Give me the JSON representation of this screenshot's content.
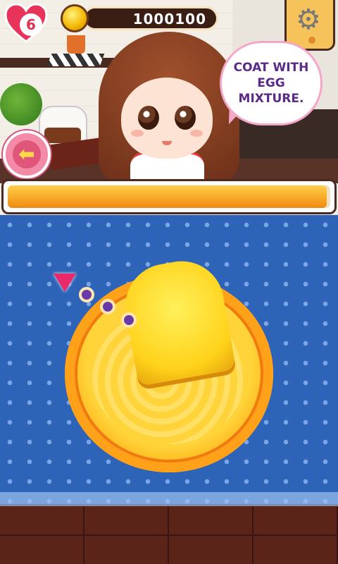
{
  "hud": {
    "lives": "6",
    "coins": "1000100"
  },
  "speech": {
    "text": "COAT WITH EGG MIXTURE."
  },
  "progress": {
    "value": 0.99
  },
  "colors": {
    "accent_pink": "#e82a6a",
    "progress_orange": "#f08a10",
    "table_blue": "#2e64b8",
    "text_purple": "#5a2a8a"
  },
  "icons": {
    "lives": "heart-icon",
    "coins": "coin-icon",
    "settings": "gear-icon",
    "back": "arrow-left-icon",
    "pointer": "triangle-down-icon"
  }
}
